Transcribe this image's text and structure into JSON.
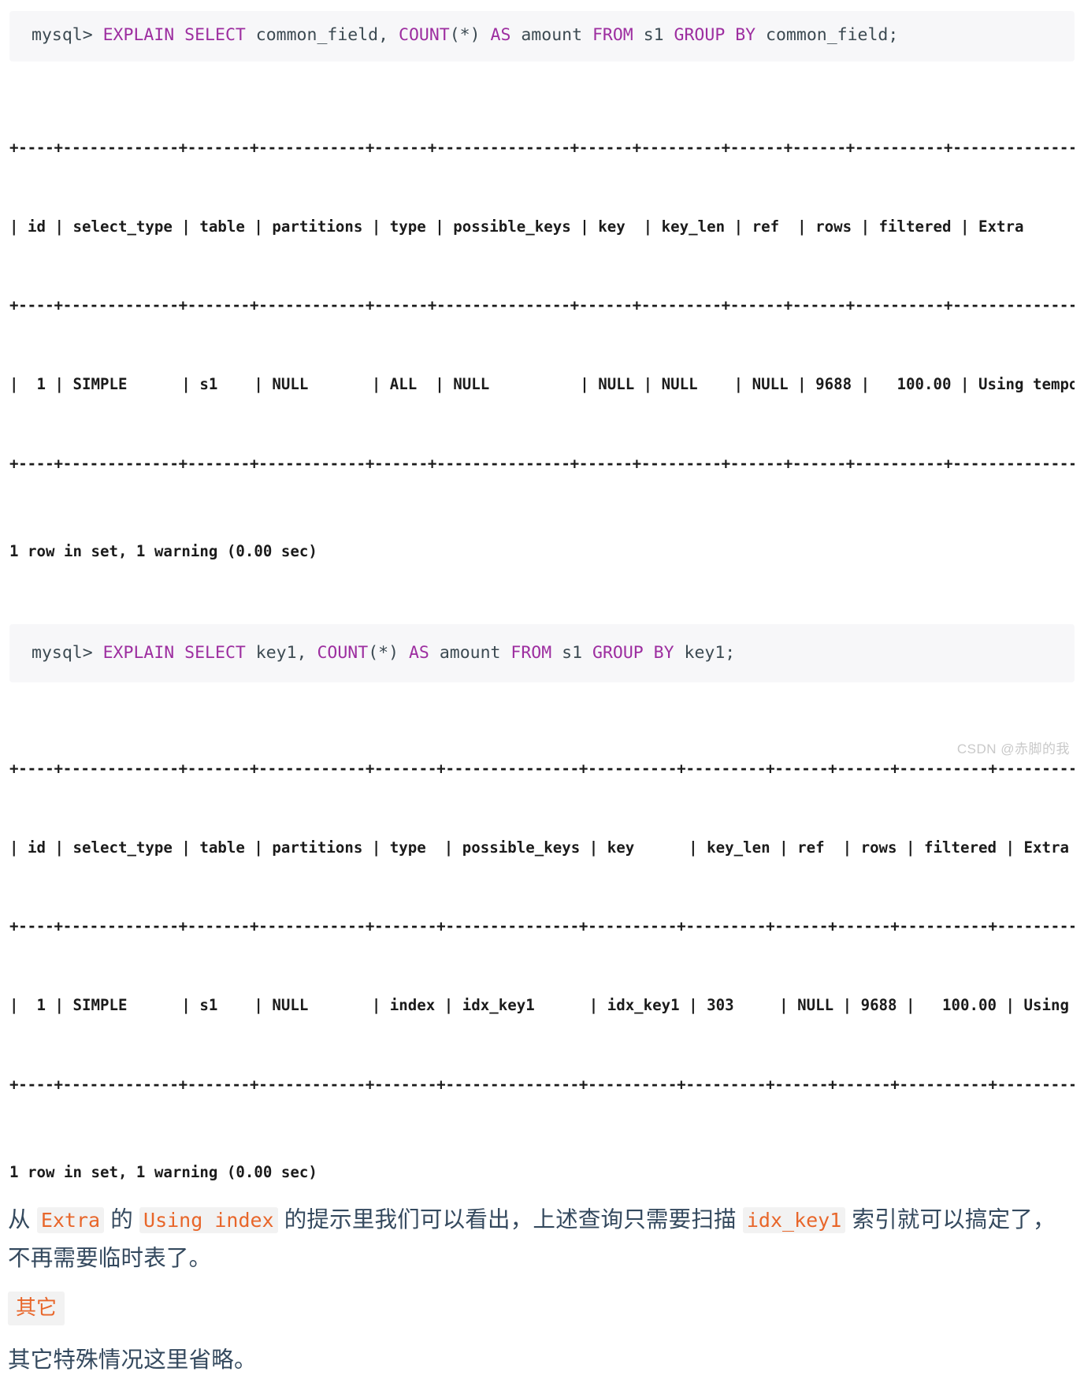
{
  "block1": {
    "prompt": "mysql> ",
    "segments": [
      {
        "t": "EXPLAIN SELECT ",
        "k": true
      },
      {
        "t": "common_field, ",
        "k": false
      },
      {
        "t": "COUNT",
        "k": true
      },
      {
        "t": "(*) ",
        "k": false
      },
      {
        "t": "AS ",
        "k": true
      },
      {
        "t": "amount ",
        "k": false
      },
      {
        "t": "FROM ",
        "k": true
      },
      {
        "t": "s1 ",
        "k": false
      },
      {
        "t": "GROUP BY ",
        "k": true
      },
      {
        "t": "common_field;",
        "k": false
      }
    ],
    "full_text": "mysql> EXPLAIN SELECT common_field, COUNT(*) AS amount FROM s1 GROUP BY common_field;"
  },
  "table1": {
    "top_rule": "+----+-------------+-------+------------+------+---------------+------+---------+------+------+----------+------------------+",
    "header_line": "| id | select_type | table | partitions | type | possible_keys | key  | key_len | ref  | rows | filtered | Extra            |",
    "mid_rule": "+----+-------------+-------+------------+------+---------------+------+---------+------+------+----------+------------------+",
    "data_line": "|  1 | SIMPLE      | s1    | NULL       | ALL  | NULL          | NULL | NULL    | NULL | 9688 |   100.00 | Using temporary  |",
    "bottom_rule": "+----+-------------+-------+------------+------+---------------+------+---------+------+------+----------+------------------+",
    "columns": [
      "id",
      "select_type",
      "table",
      "partitions",
      "type",
      "possible_keys",
      "key",
      "key_len",
      "ref",
      "rows",
      "filtered",
      "Extra"
    ],
    "rows": [
      [
        "1",
        "SIMPLE",
        "s1",
        "NULL",
        "ALL",
        "NULL",
        "NULL",
        "NULL",
        "NULL",
        "9688",
        "100.00",
        "Using temporary"
      ]
    ],
    "footer": "1 row in set, 1 warning (0.00 sec)"
  },
  "block2": {
    "prompt": "mysql> ",
    "segments": [
      {
        "t": "EXPLAIN SELECT ",
        "k": true
      },
      {
        "t": "key1, ",
        "k": false
      },
      {
        "t": "COUNT",
        "k": true
      },
      {
        "t": "(*) ",
        "k": false
      },
      {
        "t": "AS ",
        "k": true
      },
      {
        "t": "amount ",
        "k": false
      },
      {
        "t": "FROM ",
        "k": true
      },
      {
        "t": "s1 ",
        "k": false
      },
      {
        "t": "GROUP BY ",
        "k": true
      },
      {
        "t": "key1;",
        "k": false
      }
    ],
    "full_text": "mysql> EXPLAIN SELECT key1, COUNT(*) AS amount FROM s1 GROUP BY key1;"
  },
  "table2": {
    "top_rule": "+----+-------------+-------+------------+-------+---------------+----------+---------+------+------+----------+-------------+",
    "header_line": "| id | select_type | table | partitions | type  | possible_keys | key      | key_len | ref  | rows | filtered | Extra       |",
    "mid_rule": "+----+-------------+-------+------------+-------+---------------+----------+---------+------+------+----------+-------------+",
    "data_line": "|  1 | SIMPLE      | s1    | NULL       | index | idx_key1      | idx_key1 | 303     | NULL | 9688 |   100.00 | Using index |",
    "bottom_rule": "+----+-------------+-------+------------+-------+---------------+----------+---------+------+------+----------+-------------+",
    "columns": [
      "id",
      "select_type",
      "table",
      "partitions",
      "type",
      "possible_keys",
      "key",
      "key_len",
      "ref",
      "rows",
      "filtered",
      "Extra"
    ],
    "rows": [
      [
        "1",
        "SIMPLE",
        "s1",
        "NULL",
        "index",
        "idx_key1",
        "idx_key1",
        "303",
        "NULL",
        "9688",
        "100.00",
        "Using index"
      ]
    ],
    "footer": "1 row in set, 1 warning (0.00 sec)"
  },
  "paragraph": {
    "p1_a": "从 ",
    "p1_code1": "Extra",
    "p1_b": " 的 ",
    "p1_code2": "Using index",
    "p1_c": " 的提示里我们可以看出，上述查询只需要扫描 ",
    "p1_code3": "idx_key1",
    "p1_d": " 索引就可以搞定了，不再需要临时表了。"
  },
  "badge": {
    "label": "其它"
  },
  "closing": {
    "text": "其它特殊情况这里省略。"
  },
  "watermark": {
    "text": "CSDN @赤脚的我"
  },
  "colors": {
    "code_bg": "#f7f7f9",
    "sql_keyword": "#9d2ea0",
    "sql_identifier": "#1f6f78",
    "inline_code_text": "#e8662a",
    "inline_code_bg": "#f2f2f2",
    "prose_text": "#34495e",
    "ascii_text": "#1b1b1b",
    "watermark_text": "#c9c9c9"
  }
}
